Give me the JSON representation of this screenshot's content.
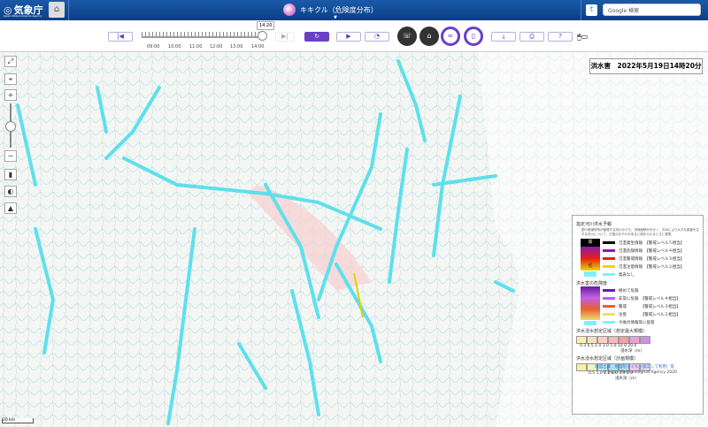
{
  "header": {
    "logo": "気象庁",
    "logo_sub": "Japan Meteorological Agency",
    "app_title": "キキクル（危険度分布）",
    "search_placeholder": "Google 検索"
  },
  "toolbar": {
    "time_tip": "14:20",
    "time_labels": [
      "09:00",
      "10:00",
      "11:00",
      "12:00",
      "13:00",
      "14:00"
    ],
    "current_time_fraction": 0.97
  },
  "map": {
    "title": "洪水害　2022年5月19日14時20分",
    "scale": "20 km",
    "legend": {
      "sec1_title": "指定河川洪水予報",
      "sec1_note": "国や都道府県が管理する河川のうち、流域面積が大きく、洪水により大きな損害を生ずる河川について、氾濫のおそれがあると認められるときに発表。",
      "sec1_items": [
        {
          "label": "氾濫発生情報　【警戒レベル５相当】",
          "color": "#000000"
        },
        {
          "label": "氾濫危険情報　【警戒レベル４相当】",
          "color": "#8a1ab0"
        },
        {
          "label": "氾濫警戒情報　【警戒レベル３相当】",
          "color": "#e82010"
        },
        {
          "label": "氾濫注意情報　【警戒レベル２相当】",
          "color": "#e8d800"
        },
        {
          "label": "発表なし",
          "color": "#80f0f8"
        }
      ],
      "high": "高",
      "low": "低",
      "sec2_title": "洪水害の危険度",
      "sec2_items": [
        {
          "label": "極めて危険",
          "color": "#6a1aa0"
        },
        {
          "label": "非常に危険　【警戒レベル４相当】",
          "color": "#c060e8"
        },
        {
          "label": "警戒　　　　【警戒レベル３相当】",
          "color": "#e86030"
        },
        {
          "label": "注意　　　　【警戒レベル２相当】",
          "color": "#e8e070"
        },
        {
          "label": "今後の情報等に留意",
          "color": "#80f0f8"
        }
      ],
      "sec3_title": "洪水浸水想定区域（想定最大規模）",
      "sec3_values": "0.3 0.5 1.0 3.0 5.0 10.0 20.0",
      "sec3_colors": [
        "#f8f0a8",
        "#f8e0c0",
        "#f8d0c8",
        "#f8b8b8",
        "#f0a0a8",
        "#e8a0d8",
        "#d090e0"
      ],
      "depth_label": "浸水深（m）",
      "sec4_title": "洪水浸水想定区域（計画規模）",
      "sec4_values": "0.5 1.0 2.0 3.0 4.0 5.0",
      "sec4_colors": [
        "#f8f0a0",
        "#e8f8c0",
        "#c0f0f8",
        "#a0e8f0",
        "#b8e0f8",
        "#f0c8f0",
        "#d8d8f8"
      ]
    },
    "footer_source": "地図出典　地理院タイル（加工して利用）等",
    "copyright": "© Japan Meteorological Agency 2020"
  }
}
